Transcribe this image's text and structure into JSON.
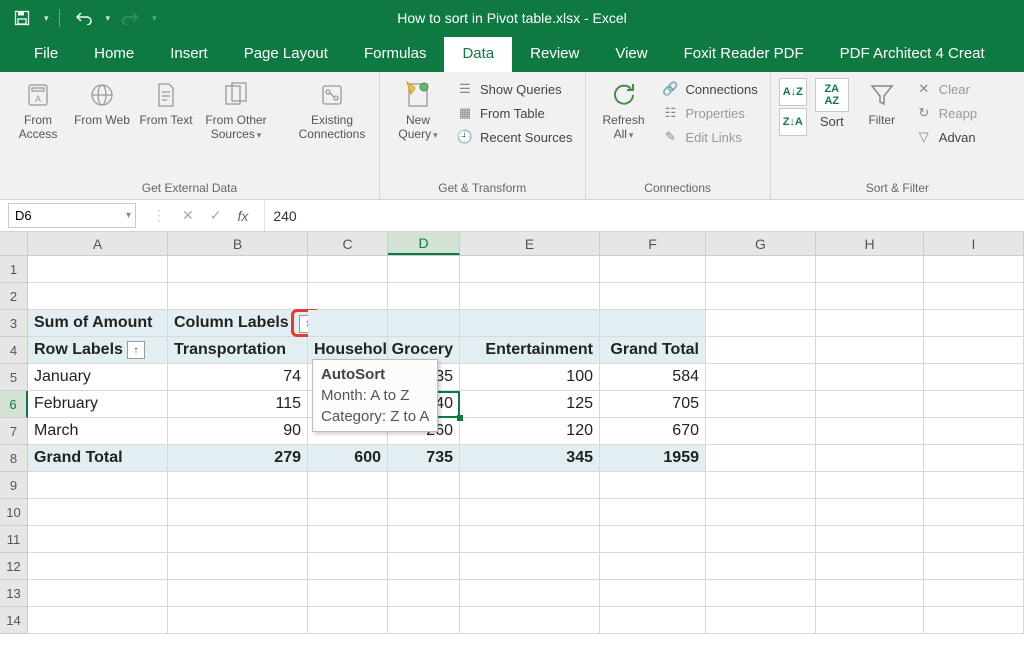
{
  "app": {
    "title": "How to sort in Pivot table.xlsx - Excel"
  },
  "qat": {
    "save": "Save",
    "undo": "Undo",
    "redo": "Redo"
  },
  "tabs": [
    "File",
    "Home",
    "Insert",
    "Page Layout",
    "Formulas",
    "Data",
    "Review",
    "View",
    "Foxit Reader PDF",
    "PDF Architect 4 Creat"
  ],
  "active_tab_index": 5,
  "ribbon": {
    "external": {
      "label": "Get External Data",
      "access": "From Access",
      "web": "From Web",
      "text": "From Text",
      "other": "From Other Sources",
      "existing": "Existing Connections"
    },
    "transform": {
      "label": "Get & Transform",
      "newquery": "New Query",
      "showqueries": "Show Queries",
      "fromtable": "From Table",
      "recent": "Recent Sources"
    },
    "connections": {
      "label": "Connections",
      "refresh": "Refresh All",
      "conn": "Connections",
      "props": "Properties",
      "edit": "Edit Links"
    },
    "sortfilter": {
      "label": "Sort & Filter",
      "az": "A→Z",
      "za": "Z→A",
      "sort": "Sort",
      "filter": "Filter",
      "clear": "Clear",
      "reapply": "Reapp",
      "advanced": "Advan"
    }
  },
  "formula_bar": {
    "name_box": "D6",
    "value": "240"
  },
  "columns": [
    "A",
    "B",
    "C",
    "D",
    "E",
    "F",
    "G",
    "H",
    "I"
  ],
  "selected_col": "D",
  "selected_row": 6,
  "pivot": {
    "corner": "Sum of Amount",
    "col_labels_text": "Column Labels",
    "row_labels_text": "Row Labels",
    "cols": [
      "Transportation",
      "Household",
      "Grocery",
      "Entertainment",
      "Grand Total"
    ],
    "rows": [
      "January",
      "February",
      "March",
      "Grand Total"
    ],
    "data": [
      [
        74,
        null,
        235,
        100,
        584
      ],
      [
        115,
        null,
        240,
        125,
        705
      ],
      [
        90,
        null,
        260,
        120,
        670
      ],
      [
        279,
        600,
        735,
        345,
        1959
      ]
    ]
  },
  "tooltip": {
    "title": "AutoSort",
    "line1": "Month: A to Z",
    "line2": "Category: Z to A"
  }
}
